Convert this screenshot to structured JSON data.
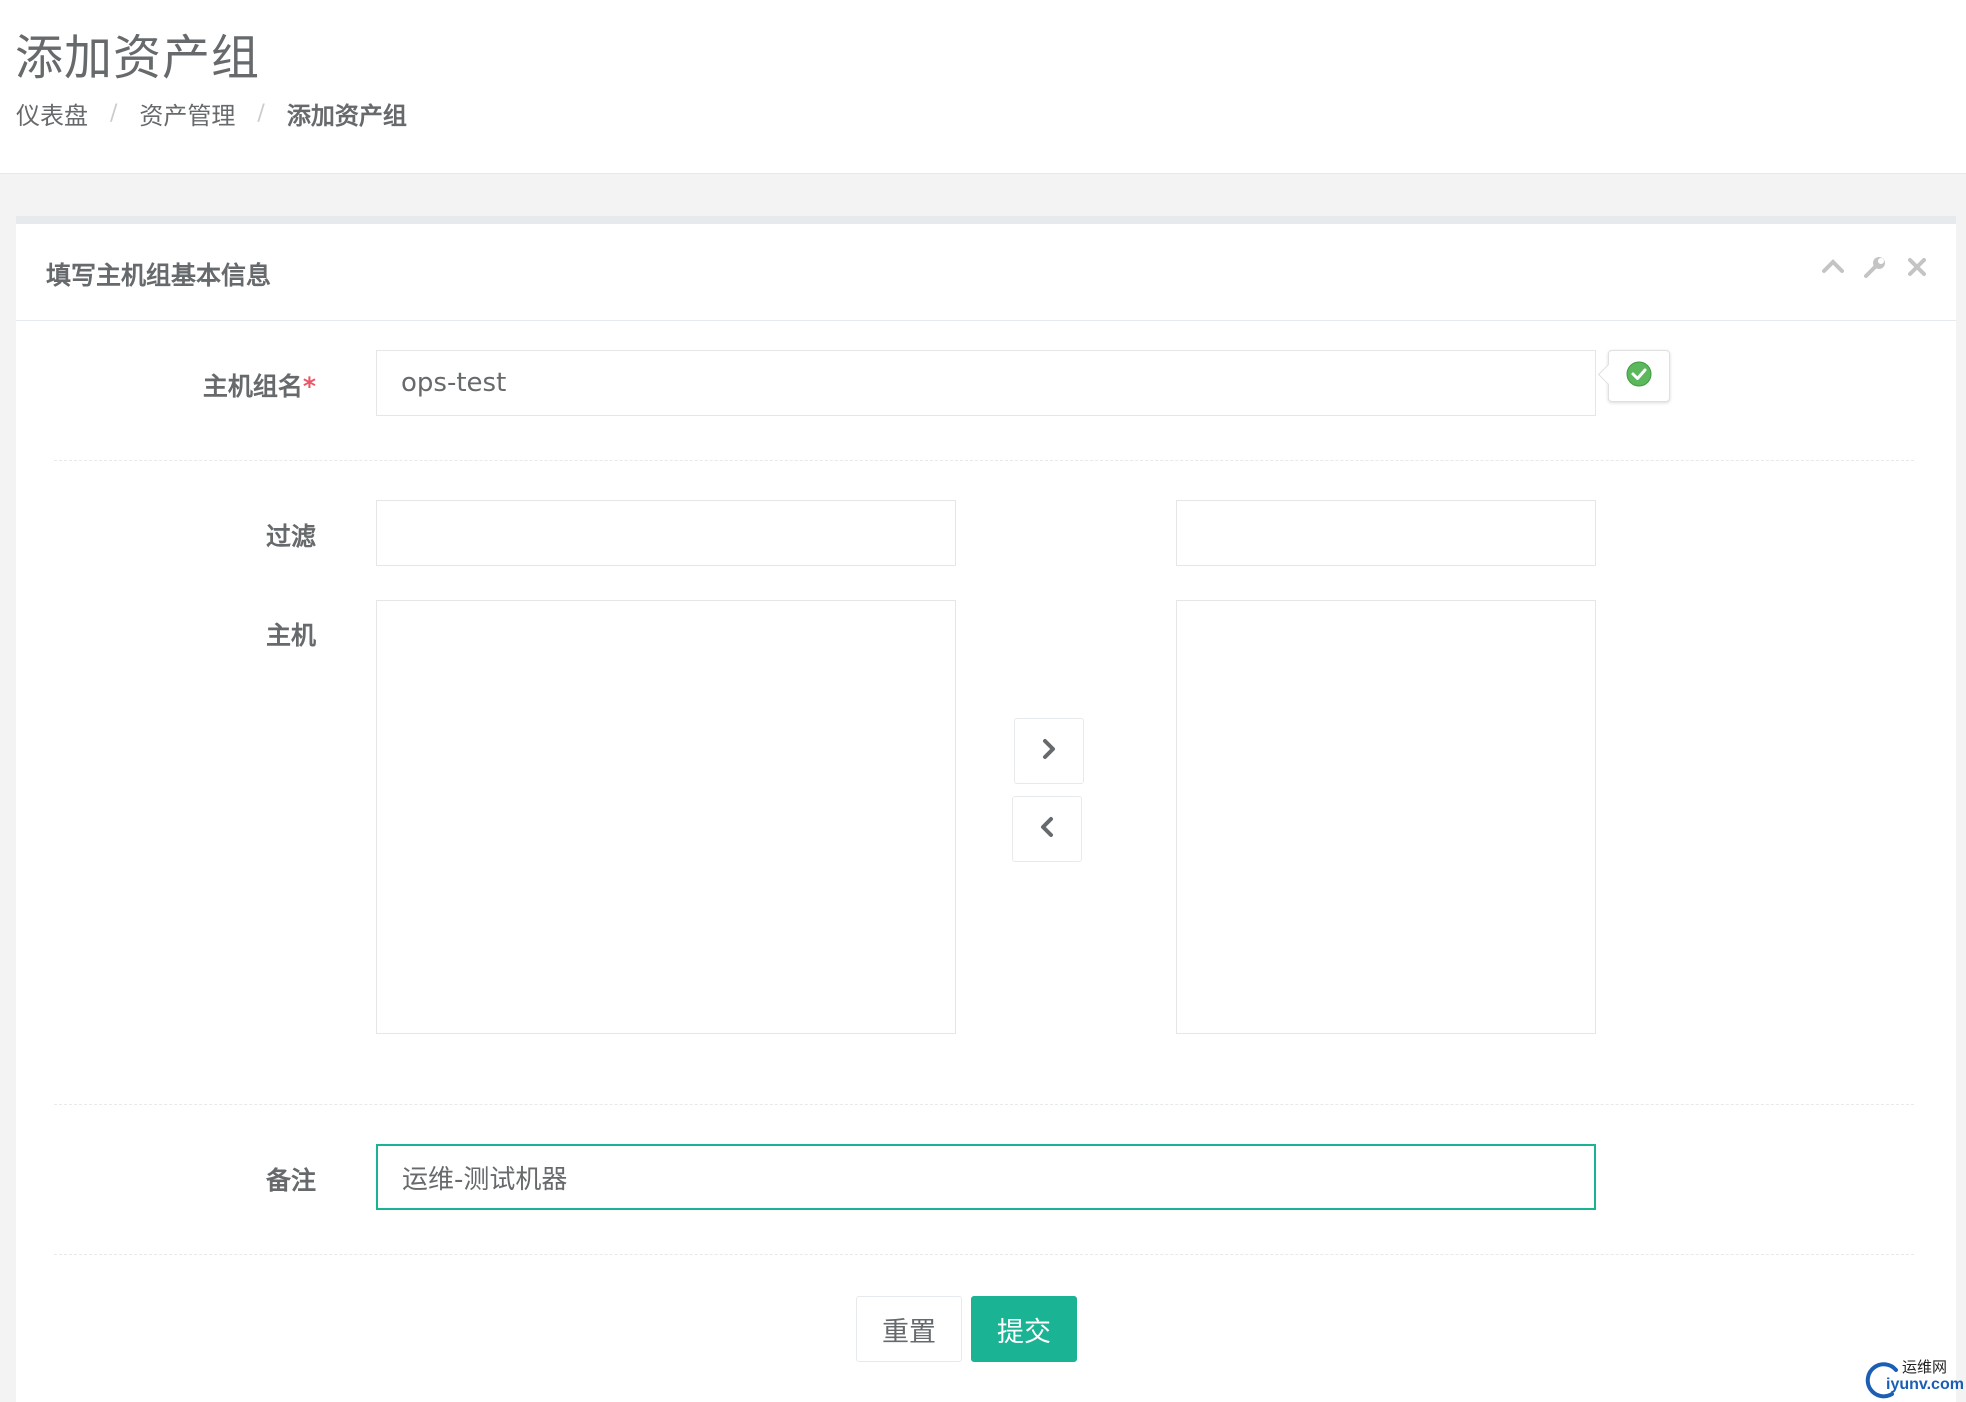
{
  "page": {
    "title": "添加资产组",
    "breadcrumb": [
      {
        "label": "仪表盘"
      },
      {
        "label": "资产管理"
      },
      {
        "label": "添加资产组"
      }
    ],
    "breadcrumb_separator": "/"
  },
  "panel": {
    "title": "填写主机组基本信息",
    "tools": [
      {
        "icon": "chevron-up-icon"
      },
      {
        "icon": "wrench-icon"
      },
      {
        "icon": "close-icon"
      }
    ]
  },
  "form": {
    "group_name": {
      "label": "主机组名",
      "required_mark": "*",
      "value": "ops-test",
      "valid_icon": "check-circle-icon"
    },
    "filter": {
      "label": "过滤",
      "left_value": "",
      "right_value": ""
    },
    "hosts": {
      "label": "主机",
      "available": [],
      "selected": []
    },
    "move_right_icon": "chevron-right-icon",
    "move_left_icon": "chevron-left-icon",
    "remark": {
      "label": "备注",
      "value": "运维-测试机器"
    },
    "reset_label": "重置",
    "submit_label": "提交"
  },
  "watermark": {
    "top": "运维网",
    "bottom": "iyunv.com"
  },
  "colors": {
    "primary": "#1ab394",
    "required": "#ed5565",
    "text": "#676a6c"
  }
}
